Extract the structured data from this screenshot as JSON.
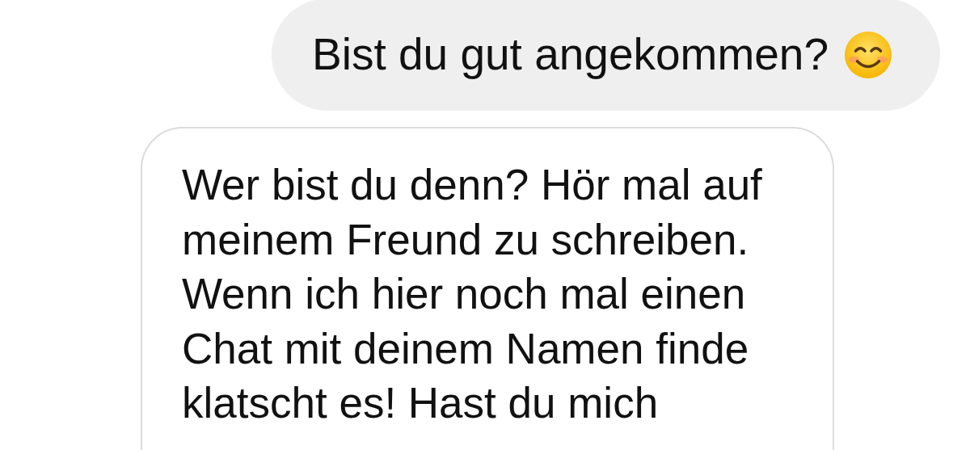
{
  "messages": [
    {
      "kind": "outgoing",
      "text": "Bist du gut angekommen?",
      "has_emoji": true
    },
    {
      "kind": "incoming",
      "text": "Wer bist du denn? Hör mal auf\nmeinem Freund zu schreiben.\nWenn ich hier noch mal einen\nChat mit deinem Namen finde\nklatscht es! Hast du mich"
    }
  ]
}
